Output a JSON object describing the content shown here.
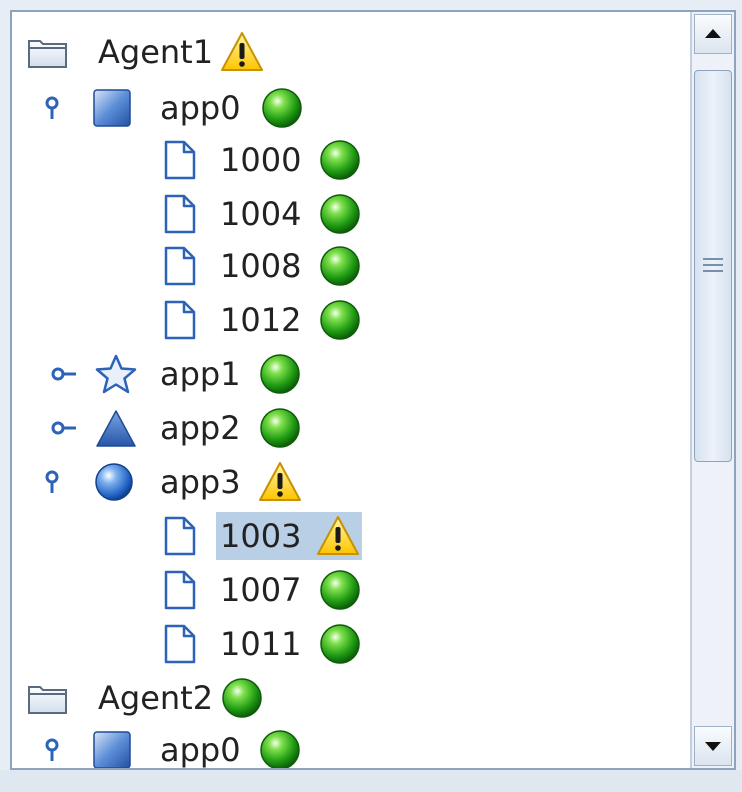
{
  "tree": {
    "agent1": {
      "label": "Agent1",
      "status_icon": "warning-icon"
    },
    "agent1_app0": {
      "label": "app0",
      "status_icon": "green-ok-icon"
    },
    "a1_1000": {
      "label": "1000",
      "status_icon": "green-ok-icon"
    },
    "a1_1004": {
      "label": "1004",
      "status_icon": "green-ok-icon"
    },
    "a1_1008": {
      "label": "1008",
      "status_icon": "green-ok-icon"
    },
    "a1_1012": {
      "label": "1012",
      "status_icon": "green-ok-icon"
    },
    "agent1_app1": {
      "label": "app1",
      "status_icon": "green-ok-icon"
    },
    "agent1_app2": {
      "label": "app2",
      "status_icon": "green-ok-icon"
    },
    "agent1_app3": {
      "label": "app3",
      "status_icon": "warning-icon"
    },
    "a3_1003": {
      "label": "1003",
      "status_icon": "warning-icon",
      "selected": true
    },
    "a3_1007": {
      "label": "1007",
      "status_icon": "green-ok-icon"
    },
    "a3_1011": {
      "label": "1011",
      "status_icon": "green-ok-icon"
    },
    "agent2": {
      "label": "Agent2",
      "status_icon": "green-ok-icon"
    },
    "agent2_app0": {
      "label": "app0",
      "status_icon": "green-ok-icon"
    }
  },
  "colors": {
    "selection": "#b8cfe5",
    "ok_green": "#2faa1d",
    "warning_yellow": "#ffd21f",
    "icon_blue": "#2c63b8"
  },
  "scrollbar": {
    "up_icon": "arrow-up-icon",
    "down_icon": "arrow-down-icon",
    "grip_icon": "grip-icon"
  }
}
